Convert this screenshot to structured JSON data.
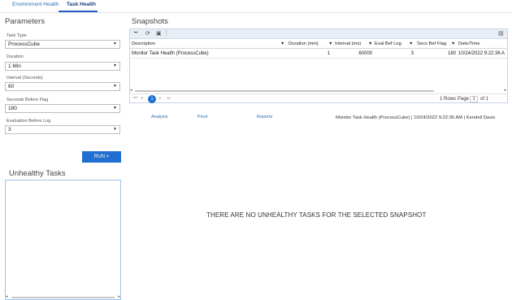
{
  "nav": {
    "tabs": [
      {
        "label": "Environment Health"
      },
      {
        "label": "Task Health"
      }
    ]
  },
  "parameters": {
    "title": "Parameters",
    "task_type": {
      "label": "Task Type",
      "value": "ProcessCube"
    },
    "duration": {
      "label": "Duration",
      "value": "1 Min"
    },
    "interval": {
      "label": "Interval (Seconds)",
      "value": "60"
    },
    "seconds_before_flag": {
      "label": "Seconds Before Flag",
      "value": "180"
    },
    "evaluation_before_log": {
      "label": "Evaluation Before Log",
      "value": "3"
    },
    "run_label": "RUN >"
  },
  "unhealthy": {
    "title": "Unhealthy Tasks"
  },
  "snapshots": {
    "title": "Snapshots",
    "columns": [
      "Description",
      "Duration (min)",
      "Interval (ms)",
      "Eval Bef Log",
      "Secs Bef Flag",
      "Date/Time"
    ],
    "rows": [
      {
        "description": "Monitor Task Health (ProcessCube)",
        "duration": "1",
        "interval": "60000",
        "eval": "3",
        "secs": "180",
        "datetime": "10/24/2022 9:22:36 A"
      }
    ],
    "pager": {
      "current": "1",
      "rows_text": "1 Rows",
      "page_label": "Page",
      "page_value": "1",
      "of_text": "of 1"
    }
  },
  "links": {
    "analysis": "Analysis",
    "pivot": "Pivot",
    "reports": "Reports"
  },
  "status_line": "Monitor Task Health (ProcessCube) | 10/24/2022 9:22:36 AM | Kendell Davis",
  "empty_message": "THERE ARE NO UNHEALTHY TASKS FOR THE SELECTED SNAPSHOT",
  "colors": {
    "accent": "#1f6fd1",
    "link": "#2b6cb0"
  }
}
